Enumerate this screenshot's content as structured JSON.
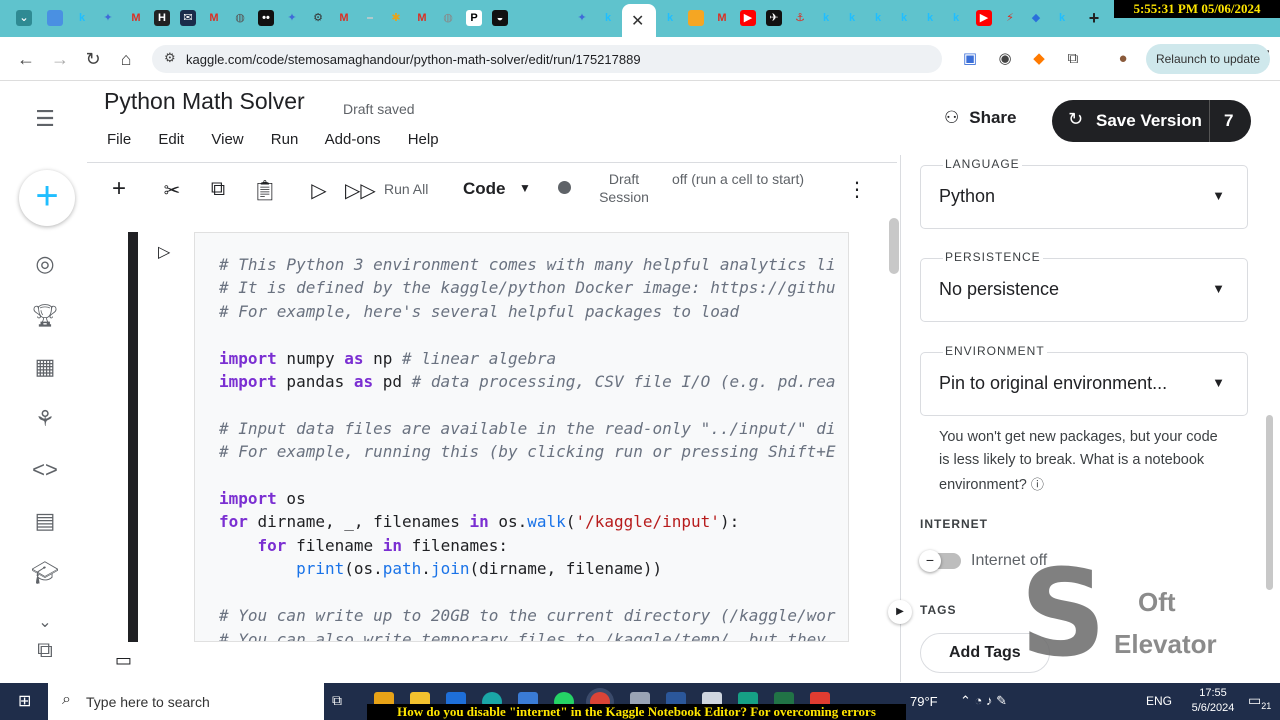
{
  "browser": {
    "url": "kaggle.com/code/stemosamaghandour/python-math-solver/edit/run/175217889",
    "relaunch_label": "Relaunch to update",
    "clock_overlay": "5:55:31 PM 05/06/2024"
  },
  "notebook": {
    "title": "Python Math Solver",
    "status": "Draft saved",
    "menu": [
      "File",
      "Edit",
      "View",
      "Run",
      "Add-ons",
      "Help"
    ],
    "share_label": "Share",
    "save_version_label": "Save Version",
    "version_count": "7"
  },
  "toolbar": {
    "run_all_label": "Run All",
    "cell_type": "Code",
    "session_label": "Draft Session",
    "session_status": "off (run a cell to start)"
  },
  "code_lines": [
    "# This Python 3 environment comes with many helpful analytics li",
    "# It is defined by the kaggle/python Docker image: https://githu",
    "# For example, here's several helpful packages to load",
    "",
    "import numpy as np # linear algebra",
    "import pandas as pd # data processing, CSV file I/O (e.g. pd.rea",
    "",
    "# Input data files are available in the read-only \"../input/\" di",
    "# For example, running this (by clicking run or pressing Shift+E",
    "",
    "import os",
    "for dirname, _, filenames in os.walk('/kaggle/input'):",
    "    for filename in filenames:",
    "        print(os.path.join(dirname, filename))",
    "",
    "# You can write up to 20GB to the current directory (/kaggle/wor",
    "# You can also write temporary files to /kaggle/temp/, but they"
  ],
  "settings": {
    "language": {
      "label": "LANGUAGE",
      "value": "Python"
    },
    "persistence": {
      "label": "PERSISTENCE",
      "value": "No persistence"
    },
    "environment": {
      "label": "ENVIRONMENT",
      "value": "Pin to original environment..."
    },
    "environment_note": "You won't get new packages, but your code is less likely to break. What is a notebook environment?",
    "internet_heading": "INTERNET",
    "internet_toggle_label": "Internet off",
    "tags_heading": "TAGS",
    "add_tags_label": "Add Tags"
  },
  "watermark": {
    "line1": "Oft",
    "line2": "Elevator"
  },
  "taskbar": {
    "search_placeholder": "Type here to search",
    "weather": "79°F",
    "language": "ENG",
    "time": "17:55",
    "date": "5/6/2024",
    "notifications": "21"
  },
  "caption": "How do you disable \"internet\" in the Kaggle Notebook Editor? For overcoming errors",
  "colors": {
    "accent": "#20beff",
    "tabbar": "#5fc3cd",
    "dark": "#202124"
  }
}
